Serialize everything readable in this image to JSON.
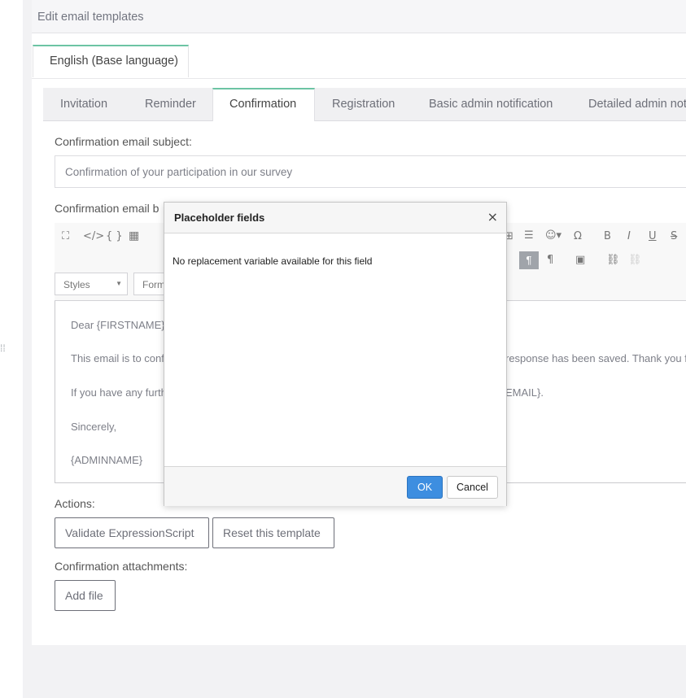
{
  "page": {
    "title": "Edit email templates"
  },
  "language_tab": {
    "label": "English (Base language)"
  },
  "tabs": [
    {
      "label": "Invitation"
    },
    {
      "label": "Reminder"
    },
    {
      "label": "Confirmation"
    },
    {
      "label": "Registration"
    },
    {
      "label": "Basic admin notification"
    },
    {
      "label": "Detailed admin not"
    }
  ],
  "active_tab": "Confirmation",
  "subject": {
    "label": "Confirmation email subject:",
    "value": "Confirmation of your participation in our survey"
  },
  "body": {
    "label": "Confirmation email b",
    "styles_select": "Styles",
    "format_select": "Form",
    "lines": [
      "Dear {FIRSTNAME}",
      "This email is to conf",
      "response has been saved. Thank you f",
      "If you have any furth",
      "EMAIL}.",
      "Sincerely,",
      "{ADMINNAME}"
    ]
  },
  "toolbar_icons": [
    "maximize-icon",
    "source-icon",
    "braces-icon",
    "grid-icon",
    "table-icon",
    "hr-icon",
    "emoji-icon",
    "omega-icon",
    "bold-icon",
    "italic-icon",
    "underline-icon",
    "strike-icon",
    "ltr-icon",
    "rtl-icon",
    "image-icon",
    "link-icon",
    "unlink-icon"
  ],
  "actions": {
    "label": "Actions:",
    "validate": "Validate ExpressionScript",
    "reset": "Reset this template"
  },
  "attachments": {
    "label": "Confirmation attachments:",
    "add": "Add file"
  },
  "modal": {
    "title": "Placeholder fields",
    "close": "×",
    "message": "No replacement variable available for this field",
    "ok": "OK",
    "cancel": "Cancel"
  },
  "colors": {
    "accent": "#6cc4a4",
    "primary_button": "#3d8ee0"
  }
}
